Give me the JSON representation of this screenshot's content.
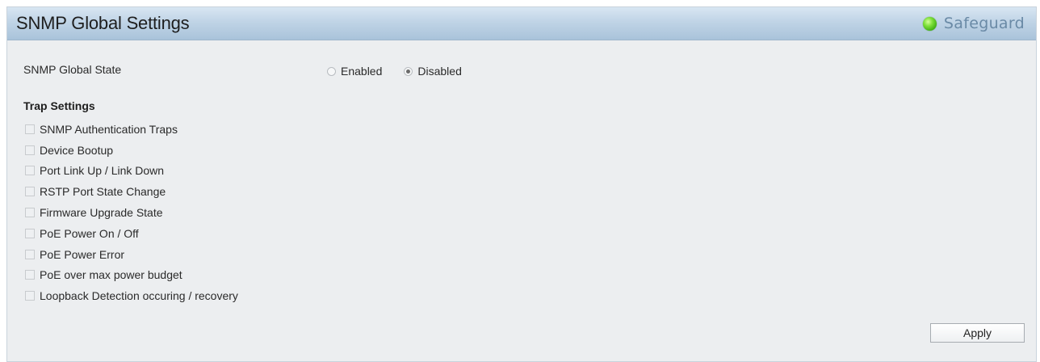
{
  "header": {
    "title": "SNMP Global Settings",
    "safeguard_label": "Safeguard",
    "safeguard_status_color": "#5ccc1e"
  },
  "global_state": {
    "label": "SNMP Global State",
    "options": [
      {
        "label": "Enabled",
        "selected": false
      },
      {
        "label": "Disabled",
        "selected": true
      }
    ]
  },
  "trap_settings": {
    "title": "Trap Settings",
    "items": [
      {
        "label": "SNMP Authentication Traps",
        "checked": false
      },
      {
        "label": "Device Bootup",
        "checked": false
      },
      {
        "label": "Port Link Up / Link Down",
        "checked": false
      },
      {
        "label": "RSTP Port State Change",
        "checked": false
      },
      {
        "label": "Firmware Upgrade State",
        "checked": false
      },
      {
        "label": "PoE Power On / Off",
        "checked": false
      },
      {
        "label": "PoE Power Error",
        "checked": false
      },
      {
        "label": "PoE over max power budget",
        "checked": false
      },
      {
        "label": "Loopback Detection occuring / recovery",
        "checked": false
      }
    ]
  },
  "actions": {
    "apply_label": "Apply"
  }
}
